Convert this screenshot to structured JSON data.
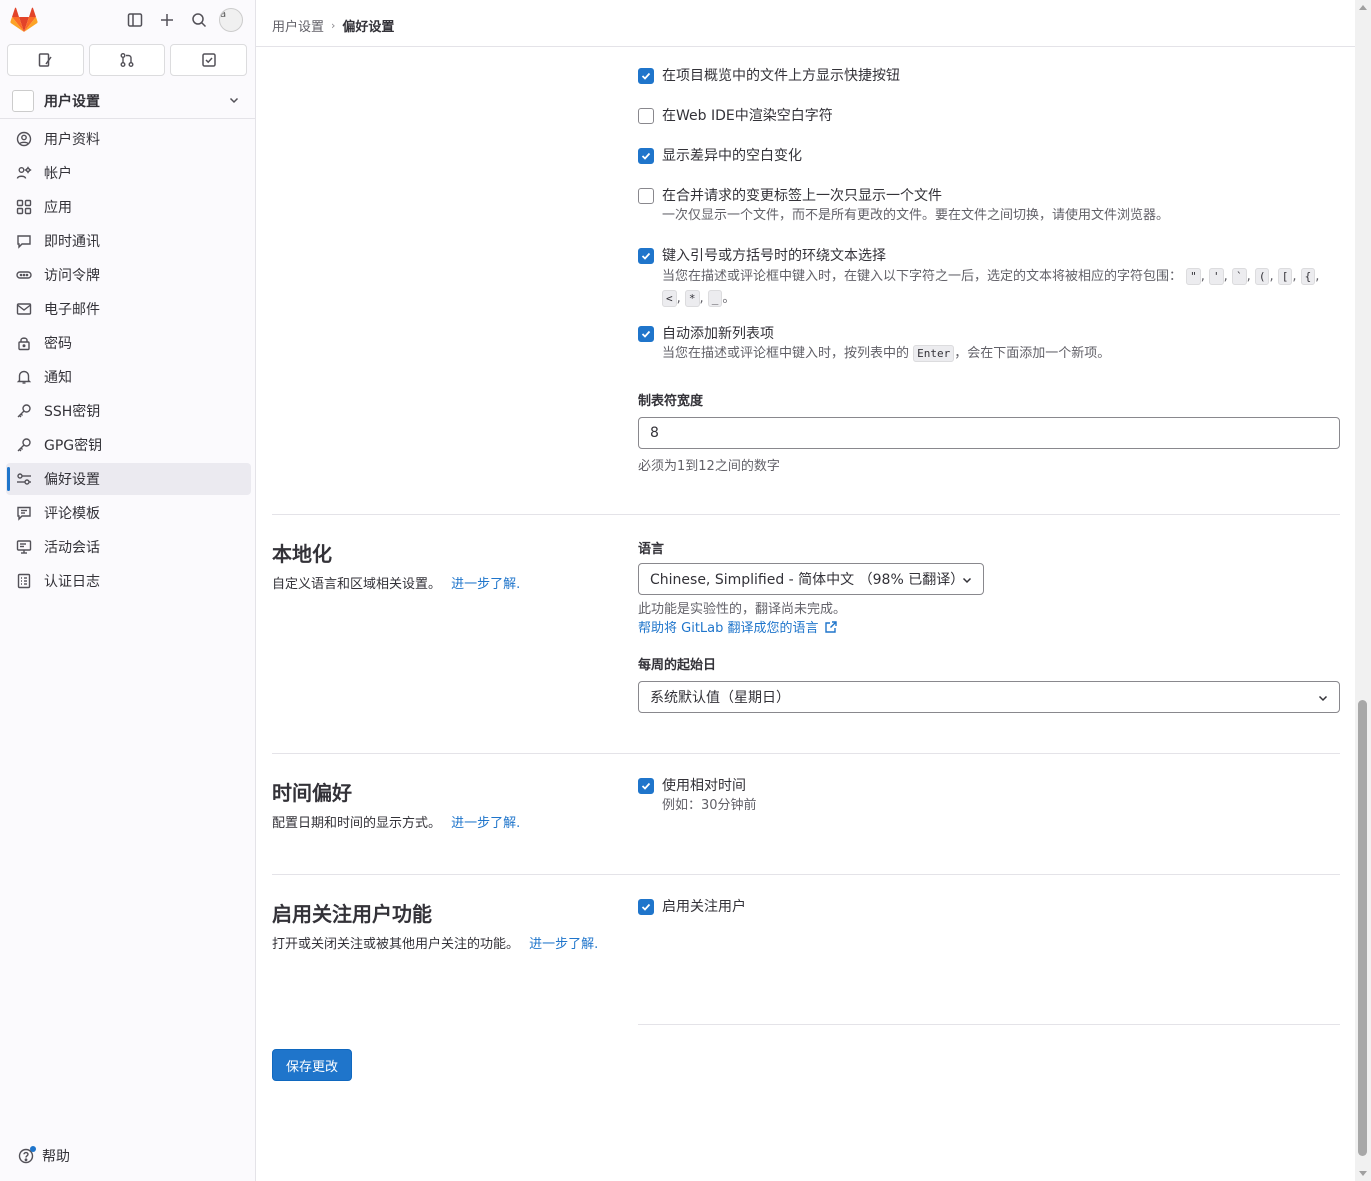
{
  "sidebar": {
    "context_title": "用户设置",
    "avatar_alt": "a",
    "items": [
      {
        "label": "用户资料",
        "icon": "profile-icon"
      },
      {
        "label": "帐户",
        "icon": "account-icon"
      },
      {
        "label": "应用",
        "icon": "applications-icon"
      },
      {
        "label": "即时通讯",
        "icon": "chat-icon"
      },
      {
        "label": "访问令牌",
        "icon": "token-icon"
      },
      {
        "label": "电子邮件",
        "icon": "mail-icon"
      },
      {
        "label": "密码",
        "icon": "lock-icon"
      },
      {
        "label": "通知",
        "icon": "bell-icon"
      },
      {
        "label": "SSH密钥",
        "icon": "key-icon"
      },
      {
        "label": "GPG密钥",
        "icon": "key-icon"
      },
      {
        "label": "偏好设置",
        "icon": "preferences-icon",
        "active": true
      },
      {
        "label": "评论模板",
        "icon": "comment-template-icon"
      },
      {
        "label": "活动会话",
        "icon": "monitor-icon"
      },
      {
        "label": "认证日志",
        "icon": "log-icon"
      }
    ],
    "help_label": "帮助"
  },
  "breadcrumb": {
    "parent": "用户设置",
    "current": "偏好设置"
  },
  "behavior": {
    "options": [
      {
        "label": "在项目概览中的文件上方显示快捷按钮",
        "checked": true
      },
      {
        "label": "在Web IDE中渲染空白字符",
        "checked": false
      },
      {
        "label": "显示差异中的空白变化",
        "checked": true
      },
      {
        "label": "在合并请求的变更标签上一次只显示一个文件",
        "checked": false,
        "help": "一次仅显示一个文件，而不是所有更改的文件。要在文件之间切换，请使用文件浏览器。"
      },
      {
        "label": "键入引号或方括号时的环绕文本选择",
        "checked": true,
        "help_prefix": "当您在描述或评论框中键入时，在键入以下字符之一后，选定的文本将被相应的字符包围："
      },
      {
        "label": "自动添加新列表项",
        "checked": true,
        "help_before": "当您在描述或评论框中键入时，按列表中的",
        "help_after": "，会在下面添加一个新项。"
      }
    ],
    "chars": [
      "\"",
      "'",
      "`",
      "(",
      "[",
      "{",
      "<",
      "*",
      "_"
    ],
    "enter_key": "Enter",
    "tab_width_label": "制表符宽度",
    "tab_width_value": "8",
    "tab_width_help": "必须为1到12之间的数字"
  },
  "localization": {
    "title": "本地化",
    "desc": "自定义语言和区域相关设置。",
    "learn_more": "进一步了解.",
    "language_label": "语言",
    "language_value": "Chinese, Simplified - 简体中文 （98% 已翻译）",
    "experimental_note": "此功能是实验性的，翻译尚未完成。",
    "help_translate": "帮助将 GitLab 翻译成您的语言",
    "first_day_label": "每周的起始日",
    "first_day_value": "系统默认值（星期日）"
  },
  "time": {
    "title": "时间偏好",
    "desc": "配置日期和时间的显示方式。",
    "learn_more": "进一步了解.",
    "relative_label": "使用相对时间",
    "relative_checked": true,
    "example": "例如：30分钟前"
  },
  "follow": {
    "title": "启用关注用户功能",
    "desc": "打开或关闭关注或被其他用户关注的功能。",
    "learn_more": "进一步了解.",
    "enable_label": "启用关注用户",
    "enable_checked": true
  },
  "save_label": "保存更改",
  "colors": {
    "primary": "#1f75cb",
    "text": "#333238",
    "muted": "#626168",
    "sidebar_bg": "#fbfafd",
    "active_bg": "#ebeaf0",
    "logo_orange": "#e24329"
  }
}
